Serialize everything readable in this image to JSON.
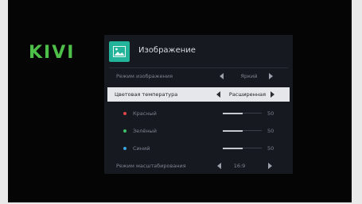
{
  "brand": "KIVI",
  "colors": {
    "accent": "#22b39a",
    "brand": "#4ec04a",
    "red_dot": "#e0464b",
    "green_dot": "#3fbf67",
    "blue_dot": "#3aa4e0"
  },
  "header": {
    "title": "Изображение",
    "icon": "picture-icon"
  },
  "menu": {
    "picture_mode": {
      "label": "Режим изображения",
      "value": "Яркий"
    },
    "color_temp": {
      "label": "Цветовая температура",
      "value": "Расширенная"
    },
    "red": {
      "label": "Красный",
      "value": "50",
      "level": 0.5
    },
    "green": {
      "label": "Зелёный",
      "value": "50",
      "level": 0.5
    },
    "blue": {
      "label": "Синий",
      "value": "50",
      "level": 0.5
    },
    "zoom_mode": {
      "label": "Режим масштабирования",
      "value": "16:9"
    }
  }
}
